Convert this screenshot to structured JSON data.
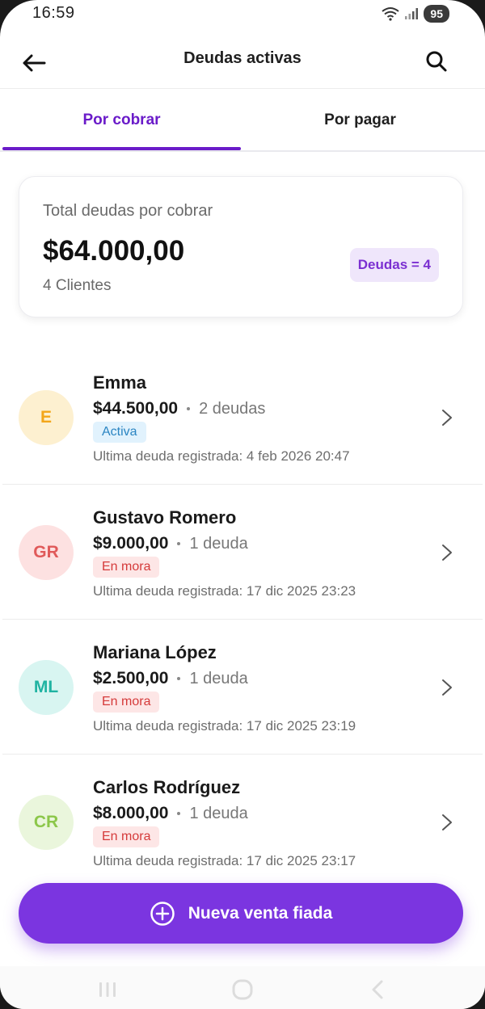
{
  "status_bar": {
    "time": "16:59",
    "battery": "95"
  },
  "header": {
    "title": "Deudas activas"
  },
  "tabs": [
    {
      "label": "Por cobrar",
      "active": true
    },
    {
      "label": "Por pagar",
      "active": false
    }
  ],
  "summary": {
    "label": "Total deudas por cobrar",
    "amount": "$64.000,00",
    "clients": "4 Clientes",
    "badge": "Deudas = 4"
  },
  "debts": [
    {
      "initials": "E",
      "name": "Emma",
      "amount": "$44.500,00",
      "count": "2 deudas",
      "status": "Activa",
      "last": "Ultima deuda registrada: 4 feb 2026 20:47",
      "avatar_bg": "#fdf0d0",
      "avatar_fg": "#f3a61a"
    },
    {
      "initials": "GR",
      "name": "Gustavo Romero",
      "amount": "$9.000,00",
      "count": "1 deuda",
      "status": "En mora",
      "last": "Ultima deuda registrada: 17 dic 2025 23:23",
      "avatar_bg": "#fde1e1",
      "avatar_fg": "#e05a5a"
    },
    {
      "initials": "ML",
      "name": "Mariana López",
      "amount": "$2.500,00",
      "count": "1 deuda",
      "status": "En mora",
      "last": "Ultima deuda registrada: 17 dic 2025 23:19",
      "avatar_bg": "#d8f5f1",
      "avatar_fg": "#1fb3a2"
    },
    {
      "initials": "CR",
      "name": "Carlos Rodríguez",
      "amount": "$8.000,00",
      "count": "1 deuda",
      "status": "En mora",
      "last": "Ultima deuda registrada: 17 dic 2025 23:17",
      "avatar_bg": "#eaf6dc",
      "avatar_fg": "#8cc74a"
    }
  ],
  "fab": {
    "label": "Nueva venta fiada"
  },
  "colors": {
    "accent": "#6a1bc9",
    "fab": "#7b35e0"
  }
}
